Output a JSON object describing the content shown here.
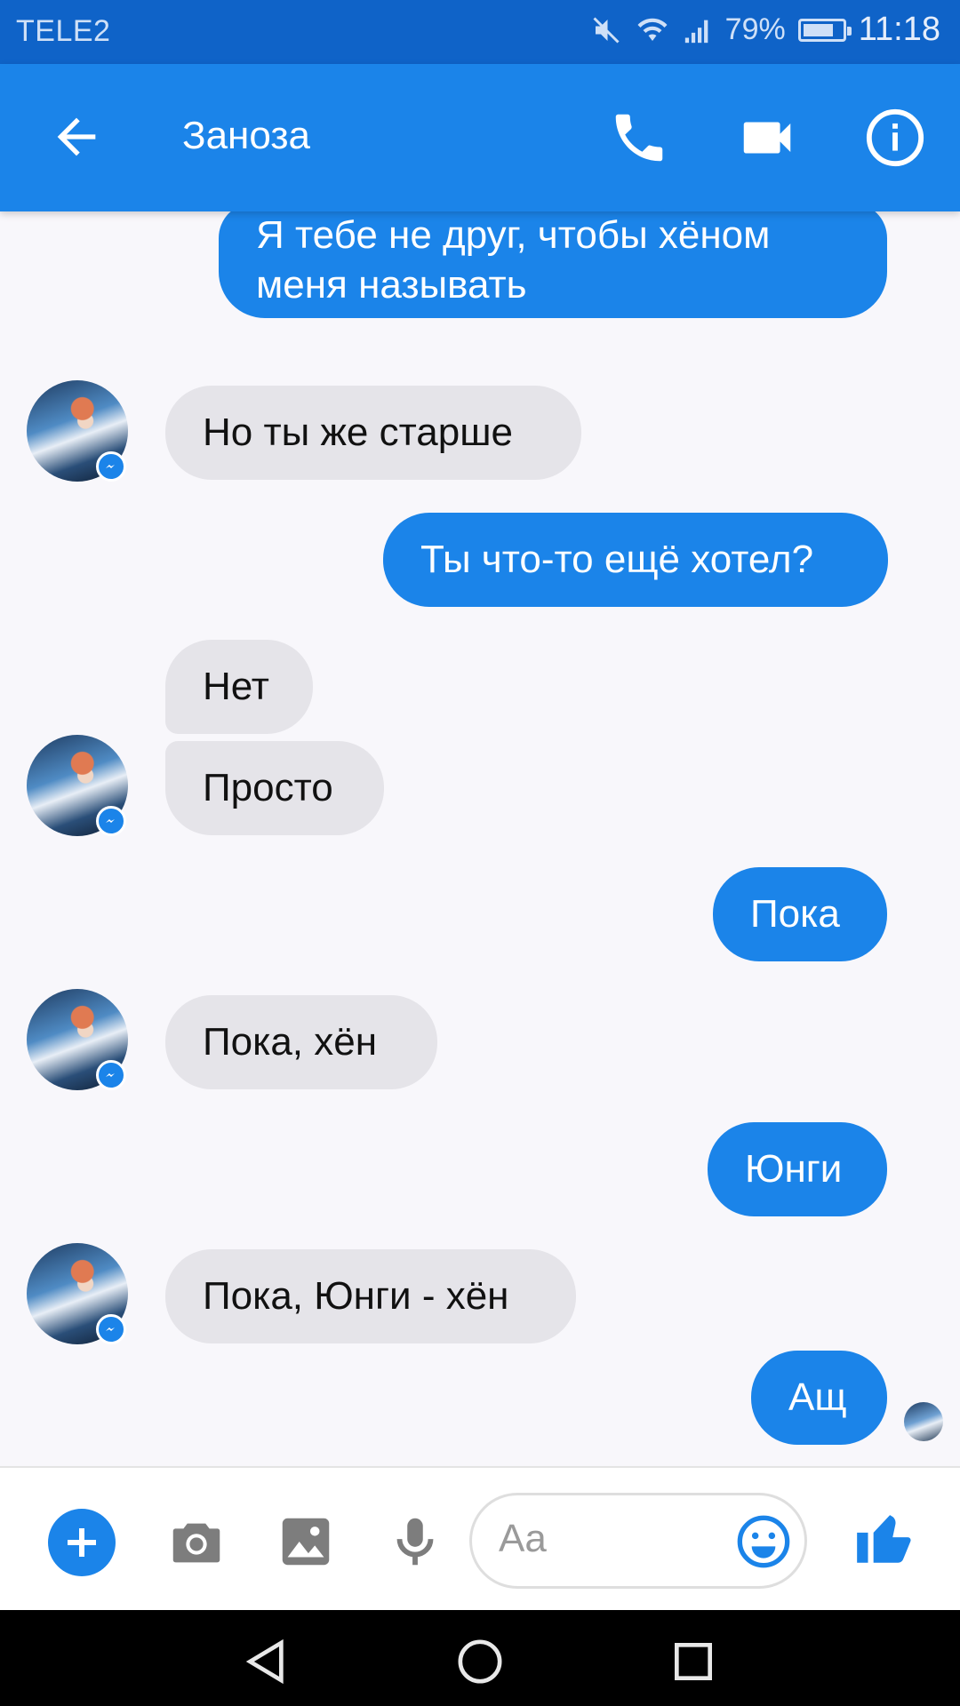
{
  "status_bar": {
    "carrier": "TELE2",
    "battery": "79%",
    "battery_level": 0.79,
    "time": "11:18"
  },
  "header": {
    "title": "Заноза"
  },
  "messages": [
    {
      "from": "me",
      "text_lines": [
        "Я тебе не друг, чтобы хёном",
        "меня называть"
      ]
    },
    {
      "from": "them",
      "text": "Но ты же старше"
    },
    {
      "from": "me",
      "text": "Ты что-то ещё хотел?"
    },
    {
      "from": "them",
      "text": "Нет"
    },
    {
      "from": "them",
      "text": "Просто"
    },
    {
      "from": "me",
      "text": "Пока"
    },
    {
      "from": "them",
      "text": "Пока, хён"
    },
    {
      "from": "me",
      "text": "Юнги"
    },
    {
      "from": "them",
      "text": "Пока, Юнги - хён"
    },
    {
      "from": "me",
      "text": "Ащ"
    }
  ],
  "composer": {
    "placeholder": "Aa"
  },
  "colors": {
    "status_bar": "#0f63c8",
    "header": "#1b84e9",
    "outgoing_bubble": "#1b84e9",
    "incoming_bubble": "#e5e4e9"
  }
}
